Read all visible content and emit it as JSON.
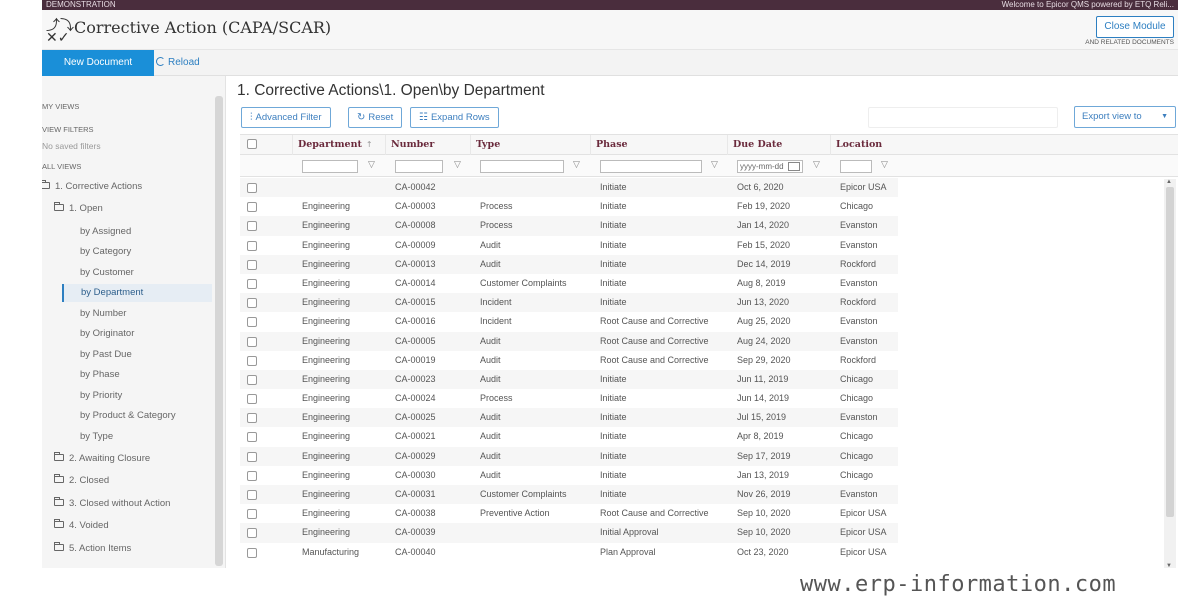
{
  "topbar": {
    "left": "DEMONSTRATION",
    "right": "Welcome to Epicor QMS powered by ETQ Reli..."
  },
  "header": {
    "title": "Corrective Action (CAPA/SCAR)",
    "close_label": "Close Module",
    "related_label": "AND RELATED DOCUMENTS"
  },
  "toolbar": {
    "new_document": "New Document",
    "reload": "Reload"
  },
  "sidebar": {
    "my_views": "MY VIEWS",
    "view_filters": "VIEW FILTERS",
    "no_saved": "No saved filters",
    "all_views": "ALL VIEWS",
    "items": [
      {
        "label": "1. Corrective Actions",
        "icon": "folder-open-icon"
      },
      {
        "label": "1. Open",
        "icon": "folder-open-icon"
      },
      {
        "label": "by Assigned"
      },
      {
        "label": "by Category"
      },
      {
        "label": "by Customer"
      },
      {
        "label": "by Department"
      },
      {
        "label": "by Number"
      },
      {
        "label": "by Originator"
      },
      {
        "label": "by Past Due"
      },
      {
        "label": "by Phase"
      },
      {
        "label": "by Priority"
      },
      {
        "label": "by Product & Category"
      },
      {
        "label": "by Type"
      },
      {
        "label": "2. Awaiting Closure",
        "icon": "folder-icon"
      },
      {
        "label": "2. Closed",
        "icon": "folder-icon"
      },
      {
        "label": "3. Closed without Action",
        "icon": "folder-icon"
      },
      {
        "label": "4. Voided",
        "icon": "folder-icon"
      },
      {
        "label": "5. Action Items",
        "icon": "folder-icon"
      }
    ]
  },
  "main": {
    "title": "1. Corrective Actions\\1. Open\\by Department",
    "advanced_filter": "Advanced Filter",
    "reset": "Reset",
    "expand_rows": "Expand Rows",
    "export": "Export view to",
    "date_placeholder": "yyyy-mm-dd"
  },
  "table": {
    "columns": [
      "Department",
      "Number",
      "Type",
      "Phase",
      "Due Date",
      "Location"
    ],
    "rows": [
      [
        "",
        "CA-00042",
        "",
        "Initiate",
        "Oct 6, 2020",
        "Epicor USA"
      ],
      [
        "Engineering",
        "CA-00003",
        "Process",
        "Initiate",
        "Feb 19, 2020",
        "Chicago"
      ],
      [
        "Engineering",
        "CA-00008",
        "Process",
        "Initiate",
        "Jan 14, 2020",
        "Evanston"
      ],
      [
        "Engineering",
        "CA-00009",
        "Audit",
        "Initiate",
        "Feb 15, 2020",
        "Evanston"
      ],
      [
        "Engineering",
        "CA-00013",
        "Audit",
        "Initiate",
        "Dec 14, 2019",
        "Rockford"
      ],
      [
        "Engineering",
        "CA-00014",
        "Customer Complaints",
        "Initiate",
        "Aug 8, 2019",
        "Evanston"
      ],
      [
        "Engineering",
        "CA-00015",
        "Incident",
        "Initiate",
        "Jun 13, 2020",
        "Rockford"
      ],
      [
        "Engineering",
        "CA-00016",
        "Incident",
        "Root Cause and Corrective",
        "Aug 25, 2020",
        "Evanston"
      ],
      [
        "Engineering",
        "CA-00005",
        "Audit",
        "Root Cause and Corrective",
        "Aug 24, 2020",
        "Evanston"
      ],
      [
        "Engineering",
        "CA-00019",
        "Audit",
        "Root Cause and Corrective",
        "Sep 29, 2020",
        "Rockford"
      ],
      [
        "Engineering",
        "CA-00023",
        "Audit",
        "Initiate",
        "Jun 11, 2019",
        "Chicago"
      ],
      [
        "Engineering",
        "CA-00024",
        "Process",
        "Initiate",
        "Jun 14, 2019",
        "Chicago"
      ],
      [
        "Engineering",
        "CA-00025",
        "Audit",
        "Initiate",
        "Jul 15, 2019",
        "Evanston"
      ],
      [
        "Engineering",
        "CA-00021",
        "Audit",
        "Initiate",
        "Apr 8, 2019",
        "Chicago"
      ],
      [
        "Engineering",
        "CA-00029",
        "Audit",
        "Initiate",
        "Sep 17, 2019",
        "Chicago"
      ],
      [
        "Engineering",
        "CA-00030",
        "Audit",
        "Initiate",
        "Jan 13, 2019",
        "Chicago"
      ],
      [
        "Engineering",
        "CA-00031",
        "Customer Complaints",
        "Initiate",
        "Nov 26, 2019",
        "Evanston"
      ],
      [
        "Engineering",
        "CA-00038",
        "Preventive Action",
        "Root Cause and Corrective",
        "Sep 10, 2020",
        "Epicor USA"
      ],
      [
        "Engineering",
        "CA-00039",
        "",
        "Initial Approval",
        "Sep 10, 2020",
        "Epicor USA"
      ],
      [
        "Manufacturing",
        "CA-00040",
        "",
        "Plan Approval",
        "Oct 23, 2020",
        "Epicor USA"
      ]
    ]
  },
  "watermark": "www.erp-information.com"
}
